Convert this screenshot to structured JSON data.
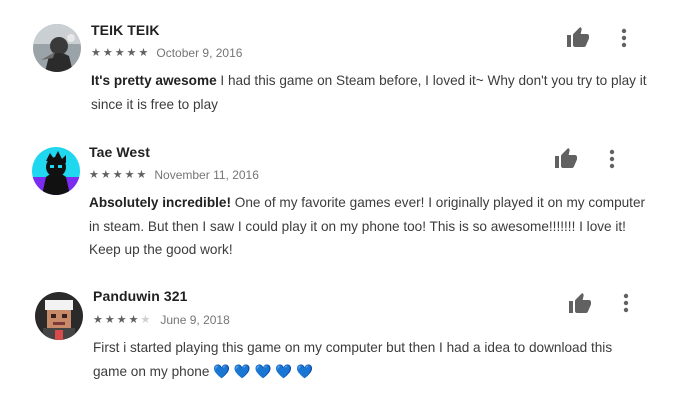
{
  "reviews": [
    {
      "author": "TEIK TEIK",
      "rating": 5,
      "max_rating": 5,
      "date": "October 9, 2016",
      "headline": "It's pretty awesome",
      "text": " I had this game on Steam before, I loved it~ Why don't you try to play it since it is free to play",
      "text_line1": " I had this game on Steam before, I loved it~ Why don't you try to play it",
      "text_line2": "since it is free to play"
    },
    {
      "author": "Tae West",
      "rating": 5,
      "max_rating": 5,
      "date": "November 11, 2016",
      "headline": "Absolutely incredible!",
      "text_line1": " One of my favorite games ever! I originally played it on my computer",
      "text_line2": "in steam. But then I saw I could play it on my phone too! This is so awesome!!!!!!! I love it!",
      "text_line3": "Keep up the good work!"
    },
    {
      "author": "Panduwin 321",
      "rating": 4,
      "max_rating": 5,
      "date": "June 9, 2018",
      "headline": "",
      "text_line1": "First i started playing this game on my computer but then I had a idea to download this",
      "text_line2": "game on my phone",
      "emoji": "💙 💙 💙 💙 💙"
    }
  ],
  "colors": {
    "icon": "#616161",
    "star_on": "#616161",
    "star_off": "#cfcfcf",
    "heart": "#1e88e5"
  },
  "icons": {
    "helpful": "thumbs-up-icon",
    "more": "more-vert-icon"
  }
}
